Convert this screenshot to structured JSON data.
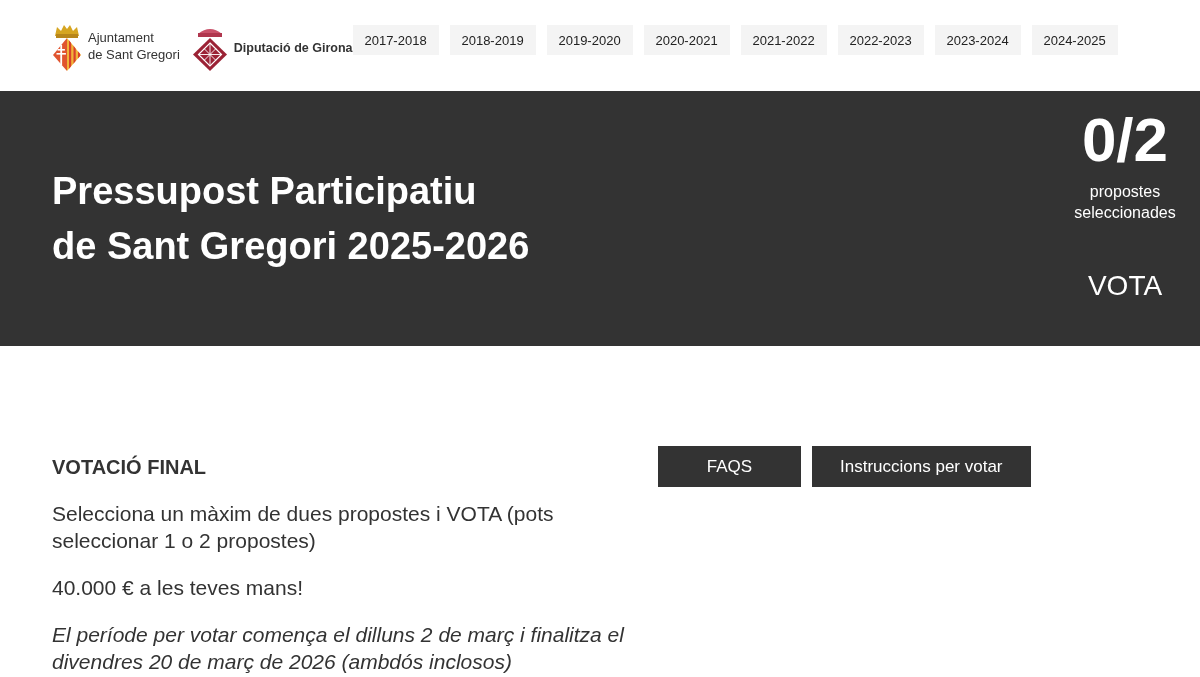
{
  "header": {
    "logos": [
      {
        "kind": "ajuntament",
        "lines": [
          "Ajuntament",
          "de Sant Gregori"
        ]
      },
      {
        "kind": "diputacio",
        "lines": [
          "Diputació de Girona"
        ]
      }
    ],
    "edition_links": [
      "2017-2018",
      "2018-2019",
      "2019-2020",
      "2020-2021",
      "2021-2022",
      "2022-2023",
      "2023-2024",
      "2024-2025"
    ]
  },
  "hero": {
    "title_lines": [
      "Pressupost Participatiu",
      "de Sant Gregori 2025-2026"
    ],
    "counter": {
      "value": "0/2",
      "label": "propostes seleccionades"
    },
    "vote_button": "VOTA"
  },
  "content": {
    "heading": "VOTACIÓ FINAL",
    "paragraphs": [
      {
        "kind": "plain",
        "text": "Selecciona un màxim de dues propostes i VOTA (pots seleccionar 1 o 2 propostes)"
      },
      {
        "kind": "plain",
        "text": "40.000 € a les teves mans!"
      },
      {
        "kind": "italic",
        "text": "El període per votar comença el dilluns 2 de març i finalitza el divendres 20 de març de 2026 (ambdós inclosos)"
      }
    ],
    "buttons": [
      "FAQS",
      "Instruccions per votar"
    ]
  }
}
